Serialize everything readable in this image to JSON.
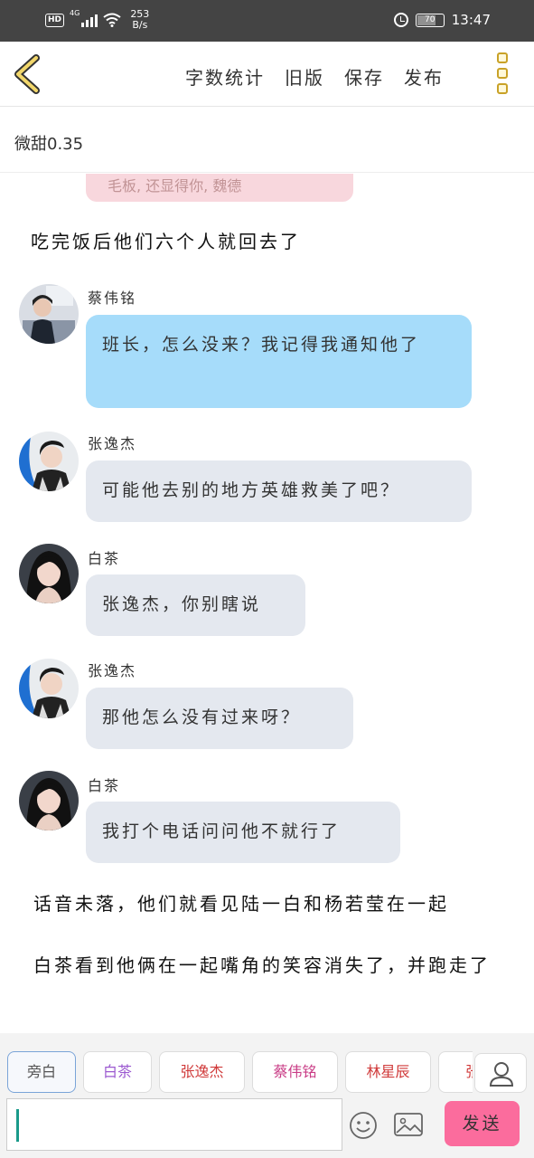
{
  "status": {
    "hd": "HD",
    "network": "4G",
    "speed_value": "253",
    "speed_unit": "B/s",
    "battery": "70",
    "time": "13:47"
  },
  "topbar": {
    "word_count": "字数统计",
    "old_version": "旧版",
    "save": "保存",
    "publish": "发布"
  },
  "title": "微甜0.35",
  "previous_bubble_text": "毛板, 还显得你, 魏德",
  "narrations": [
    "吃完饭后他们六个人就回去了",
    "话音未落，他们就看见陆一白和杨若莹在一起",
    "白茶看到他俩在一起嘴角的笑容消失了，并跑走了"
  ],
  "messages": [
    {
      "name": "蔡伟铭",
      "text": "班长，怎么没来？我记得我通知他了",
      "color": "blue",
      "avatar": "cai-weiming"
    },
    {
      "name": "张逸杰",
      "text": "可能他去别的地方英雄救美了吧？",
      "color": "gray",
      "avatar": "zhang-yijie"
    },
    {
      "name": "白茶",
      "text": "张逸杰，你别瞎说",
      "color": "gray",
      "avatar": "bai-cha"
    },
    {
      "name": "张逸杰",
      "text": "那他怎么没有过来呀？",
      "color": "gray",
      "avatar": "zhang-yijie"
    },
    {
      "name": "白茶",
      "text": "我打个电话问问他不就行了",
      "color": "gray",
      "avatar": "bai-cha"
    }
  ],
  "role_chips": [
    {
      "label": "旁白",
      "color": "#555555"
    },
    {
      "label": "白茶",
      "color": "#9b59d0"
    },
    {
      "label": "张逸杰",
      "color": "#d03a3a"
    },
    {
      "label": "蔡伟铭",
      "color": "#c93c86"
    },
    {
      "label": "林星辰",
      "color": "#d03a3a"
    },
    {
      "label": "张",
      "color": "#d03a3a"
    }
  ],
  "input": {
    "value": ""
  },
  "send_label": "发送",
  "icons": {
    "back": "back-chevron-icon",
    "menu": "kebab-menu-icon",
    "person": "person-icon",
    "emoji": "smiley-icon",
    "image": "image-icon"
  }
}
